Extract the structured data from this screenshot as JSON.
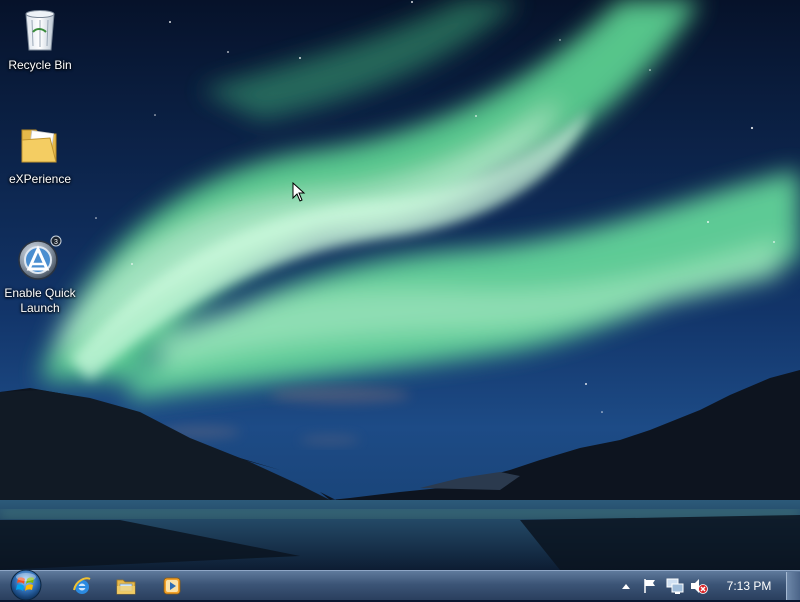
{
  "desktop": {
    "icons": [
      {
        "label": "Recycle Bin",
        "icon": "recycle-bin-icon"
      },
      {
        "label": "eXPerience",
        "icon": "folder-icon"
      },
      {
        "label": "Enable Quick Launch",
        "icon": "launcher-icon"
      }
    ]
  },
  "taskbar": {
    "start_icon": "windows-start-orb",
    "pinned": [
      {
        "icon": "internet-explorer-icon"
      },
      {
        "icon": "windows-explorer-icon"
      },
      {
        "icon": "media-player-icon"
      }
    ],
    "tray": {
      "icons": [
        "show-hidden-icons-arrow",
        "action-center-flag-icon",
        "network-icon",
        "volume-muted-icon"
      ]
    },
    "clock": "7:13 PM"
  },
  "colors": {
    "sky_top": "#07142c",
    "aurora": "#6fe8a0",
    "mountains": "#0c1420",
    "lake": "#1b3a5c",
    "taskbar": "#3c5577"
  }
}
